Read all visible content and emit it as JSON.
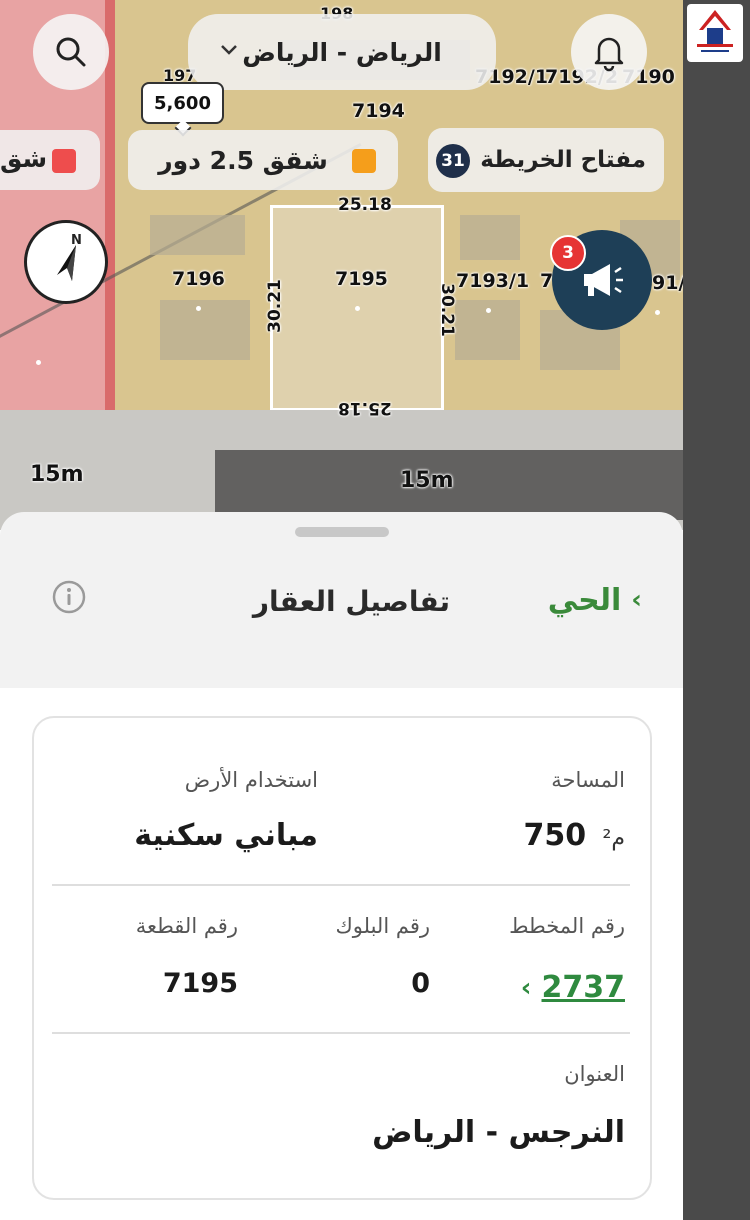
{
  "map": {
    "city_selector": "الرياض - الرياض",
    "price_tag": "5,600",
    "zone_legend_primary": "شقق 2.5 دور",
    "zone_legend_secondary": "شق",
    "map_key_label": "مفتاح الخريطة",
    "map_key_count": "31",
    "announcements_count": "3",
    "compass_label": "N",
    "parcel_labels": {
      "p7194": "7194",
      "p7196": "7196",
      "p7195": "7195",
      "p7193_1": "7193/1",
      "p7192_1": "7192/1",
      "p7192_2": "7192/2",
      "p7190": "7190",
      "p197": "197",
      "p198": "198",
      "p7_partial": "7",
      "p91_partial": "91/"
    },
    "dimensions": {
      "top": "25.18",
      "bottom": "25.18",
      "left": "30.21",
      "right": "30.21"
    },
    "street_widths": [
      "15m",
      "15m"
    ]
  },
  "sheet": {
    "title": "تفاصيل العقار",
    "back_label": "الحي"
  },
  "details": {
    "land_use_label": "استخدام الأرض",
    "land_use_value": "مباني سكنية",
    "area_label": "المساحة",
    "area_value": "750",
    "area_unit": "م²",
    "plan_number_label": "رقم المخطط",
    "plan_number_value": "2737",
    "block_number_label": "رقم البلوك",
    "block_number_value": "0",
    "plot_number_label": "رقم القطعة",
    "plot_number_value": "7195",
    "address_label": "العنوان",
    "address_value": "النرجس - الرياض"
  },
  "colors": {
    "accent_green": "#2f8a3f",
    "badge_navy": "#1f2f4a",
    "badge_red": "#e63434",
    "zone_orange": "#f59e1b",
    "zone_red": "#ee4d4d"
  }
}
